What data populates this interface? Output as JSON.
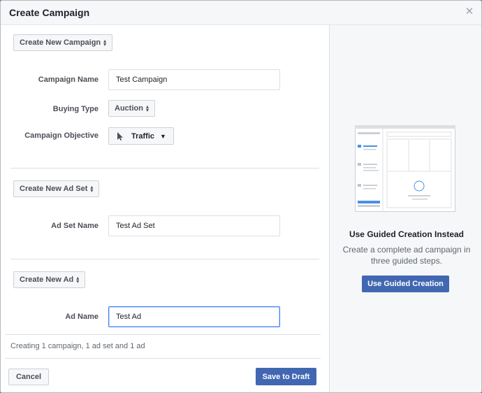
{
  "dialog": {
    "title": "Create Campaign",
    "close_icon": "close-icon"
  },
  "campaign": {
    "mode_label": "Create New Campaign",
    "name_label": "Campaign Name",
    "name_value": "Test Campaign",
    "buying_type_label": "Buying Type",
    "buying_type_value": "Auction",
    "objective_label": "Campaign Objective",
    "objective_value": "Traffic",
    "objective_icon": "cursor-arrow-icon"
  },
  "ad_set": {
    "mode_label": "Create New Ad Set",
    "name_label": "Ad Set Name",
    "name_value": "Test Ad Set"
  },
  "ad": {
    "mode_label": "Create New Ad",
    "name_label": "Ad Name",
    "name_value": "Test Ad"
  },
  "summary": "Creating 1 campaign, 1 ad set and 1 ad",
  "footer": {
    "cancel_label": "Cancel",
    "save_label": "Save to Draft"
  },
  "guided": {
    "title": "Use Guided Creation Instead",
    "description": "Create a complete ad campaign in three guided steps.",
    "button_label": "Use Guided Creation"
  },
  "colors": {
    "primary": "#4267b2",
    "focus": "#4080ff",
    "panel_bg": "#f6f7f9"
  }
}
